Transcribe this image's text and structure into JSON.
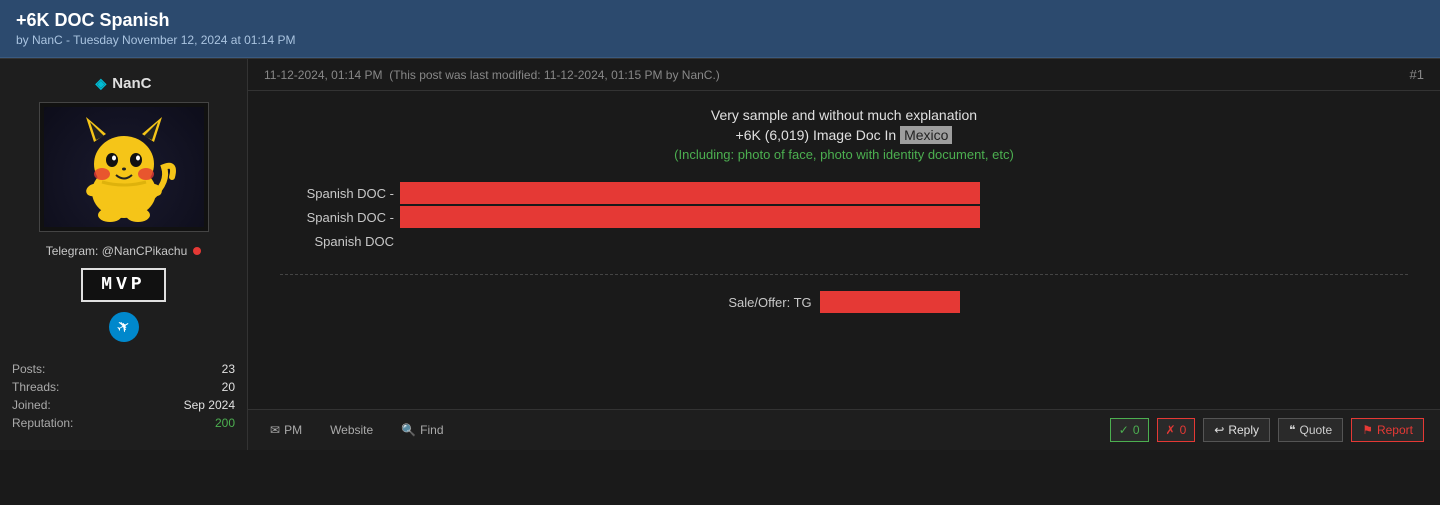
{
  "header": {
    "title": "+6K DOC Spanish",
    "meta": "by NanC - Tuesday November 12, 2024 at 01:14 PM"
  },
  "post": {
    "timestamp": "11-12-2024, 01:14 PM",
    "last_modified": "(This post was last modified: 11-12-2024, 01:15 PM by NanC.)",
    "number": "#1",
    "body": {
      "title_line1": "Very sample and without much explanation",
      "title_line2": "+6K (6,019) Image Doc In",
      "highlight_word": "Mexico",
      "green_line": "(Including: photo of face, photo with identity document, etc)",
      "doc_rows": [
        {
          "label": "Spanish DOC -"
        },
        {
          "label": "Spanish DOC -"
        },
        {
          "label": "Spanish DOC"
        }
      ],
      "sale_label": "Sale/Offer: TG"
    },
    "footer": {
      "pm_label": "PM",
      "website_label": "Website",
      "find_label": "Find",
      "upvote_count": "0",
      "downvote_count": "0",
      "reply_label": "Reply",
      "quote_label": "Quote",
      "report_label": "Report"
    }
  },
  "user": {
    "username": "NanC",
    "diamond_icon": "◈",
    "telegram": "Telegram: @NanCPikachu",
    "mvp_label": "MVP",
    "stats": {
      "posts_label": "Posts:",
      "posts_value": "23",
      "threads_label": "Threads:",
      "threads_value": "20",
      "joined_label": "Joined:",
      "joined_value": "Sep 2024",
      "reputation_label": "Reputation:",
      "reputation_value": "200"
    }
  },
  "colors": {
    "accent": "#2c4a6e",
    "redacted": "#e53935",
    "green": "#4caf50",
    "highlight_bg": "#9e9e9e"
  }
}
